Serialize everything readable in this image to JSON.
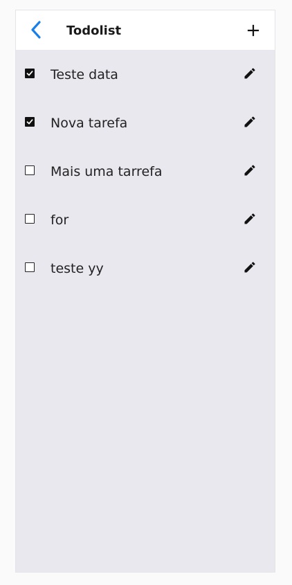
{
  "header": {
    "title": "Todolist",
    "back_icon": "chevron-left-icon",
    "add_icon": "plus-icon",
    "accent_color": "#1a7fe6"
  },
  "todos": [
    {
      "label": "Teste data",
      "done": true
    },
    {
      "label": "Nova tarefa",
      "done": true
    },
    {
      "label": "Mais uma tarrefa",
      "done": false
    },
    {
      "label": "for",
      "done": false
    },
    {
      "label": "teste yy",
      "done": false
    }
  ],
  "colors": {
    "header_bg": "#ffffff",
    "list_bg": "#e9e8ee",
    "text": "#222222"
  }
}
